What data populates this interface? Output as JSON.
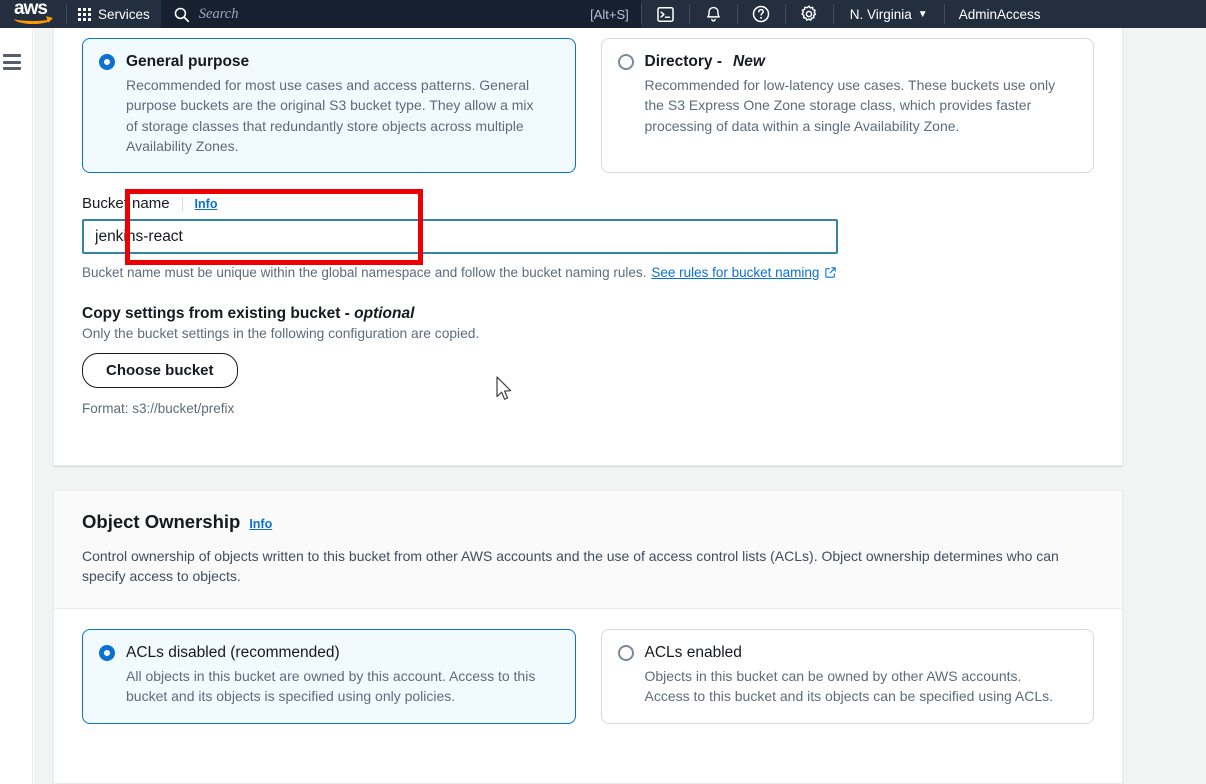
{
  "topnav": {
    "logo_text": "aws",
    "services_label": "Services",
    "search_placeholder": "Search",
    "search_value": "",
    "search_shortcut": "[Alt+S]",
    "cloudshell_icon": "cloudshell-icon",
    "notifications_icon": "bell-icon",
    "help_icon": "question-circle-icon",
    "settings_icon": "gear-icon",
    "region_label": "N. Virginia",
    "region_caret": "▼",
    "account_label": "AdminAccess"
  },
  "sidebar": {
    "menu_icon": "hamburger-icon"
  },
  "general_panel": {
    "bucket_type": {
      "options": [
        {
          "title": "General purpose",
          "title_suffix": "",
          "description": "Recommended for most use cases and access patterns. General purpose buckets are the original S3 bucket type. They allow a mix of storage classes that redundantly store objects across multiple Availability Zones.",
          "selected": true
        },
        {
          "title": "Directory - ",
          "title_suffix": "New",
          "description": "Recommended for low-latency use cases. These buckets use only the S3 Express One Zone storage class, which provides faster processing of data within a single Availability Zone.",
          "selected": false
        }
      ]
    },
    "bucket_name": {
      "label": "Bucket name",
      "info_label": "Info",
      "value": "jenkins-react",
      "placeholder": "",
      "hint_text": "Bucket name must be unique within the global namespace and follow the bucket naming rules.",
      "hint_link": "See rules for bucket naming",
      "external_link_icon": "external-link-icon"
    },
    "copy_settings": {
      "heading": "Copy settings from existing bucket - ",
      "heading_em": "optional",
      "subtext": "Only the bucket settings in the following configuration are copied.",
      "button_label": "Choose bucket",
      "format_text": "Format: s3://bucket/prefix"
    }
  },
  "ownership_panel": {
    "heading": "Object Ownership",
    "info_label": "Info",
    "description": "Control ownership of objects written to this bucket from other AWS accounts and the use of access control lists (ACLs). Object ownership determines who can specify access to objects.",
    "options": [
      {
        "title": "ACLs disabled (recommended)",
        "description": "All objects in this bucket are owned by this account. Access to this bucket and its objects is specified using only policies.",
        "selected": true
      },
      {
        "title": "ACLs enabled",
        "description": "Objects in this bucket can be owned by other AWS accounts. Access to this bucket and its objects can be specified using ACLs.",
        "selected": false
      }
    ]
  },
  "annotation": {
    "highlight_color": "#ee0000",
    "target": "bucket-name-field"
  },
  "colors": {
    "nav_background": "#232f3e",
    "accent": "#0972d3",
    "selected_tile_bg": "#f1faff",
    "page_background": "#f2f3f3"
  }
}
